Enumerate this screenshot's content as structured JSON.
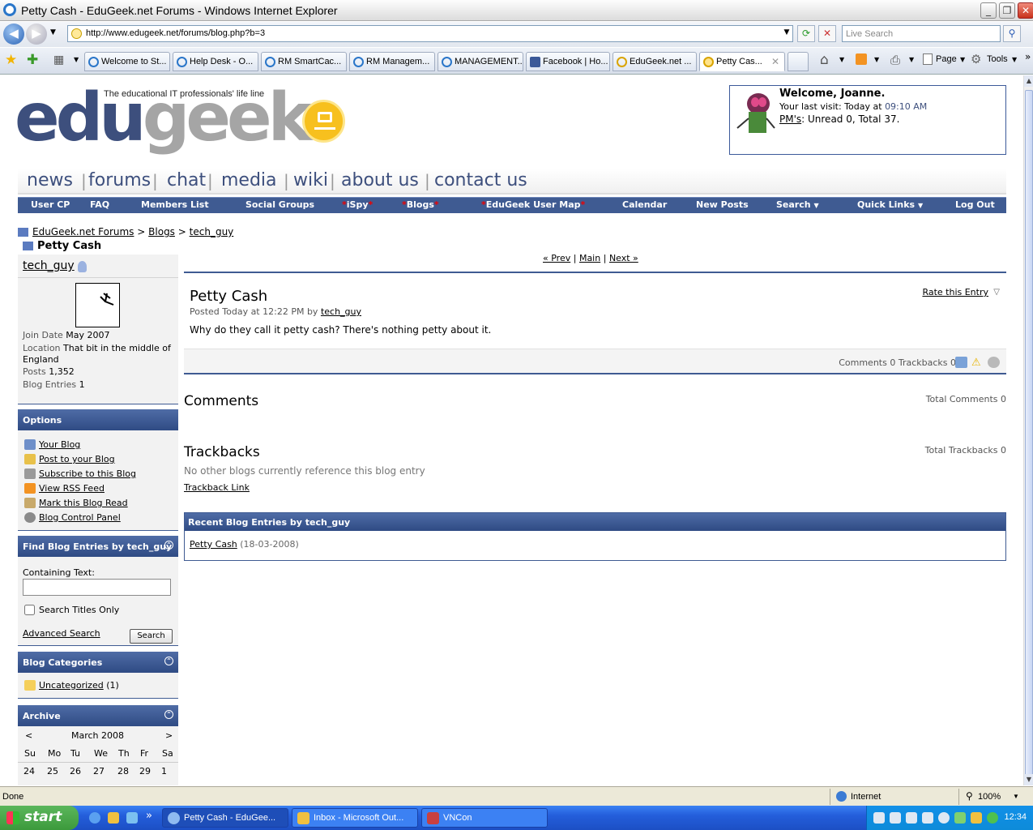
{
  "window": {
    "title": "Petty Cash - EduGeek.net Forums - Windows Internet Explorer"
  },
  "browser": {
    "url": "http://www.edugeek.net/forums/blog.php?b=3",
    "search_placeholder": "Live Search",
    "tabs": [
      "Welcome to St...",
      "Help Desk - O...",
      "RM SmartCac...",
      "RM Managem...",
      "MANAGEMENT...",
      "Facebook | Ho...",
      "EduGeek.net ...",
      "Petty Cas..."
    ],
    "toolbar": {
      "page": "Page",
      "tools": "Tools"
    }
  },
  "site": {
    "tagline": "The educational IT professionals' life line",
    "logo_left": "edu",
    "logo_right": "geek",
    "colors": {
      "nav_blue": "#3f5b92",
      "logo_blue": "#3d4f7d",
      "logo_grey": "#a5a5a5",
      "logo_yellow": "#f7c01e"
    }
  },
  "welcome": {
    "greeting": "Welcome, Joanne.",
    "last_visit_label": "Your last visit: Today at",
    "last_visit_time": "09:10 AM",
    "pms_link": "PM's",
    "pms_text": ": Unread 0, Total 37."
  },
  "main_nav": [
    "news",
    "forums",
    "chat",
    "media",
    "wiki",
    "about us",
    "contact us"
  ],
  "blue_nav": {
    "user_cp": "User CP",
    "faq": "FAQ",
    "members": "Members List",
    "groups": "Social Groups",
    "ispy": "iSpy",
    "blogs": "Blogs",
    "usermap": "EduGeek User Map",
    "calendar": "Calendar",
    "newposts": "New Posts",
    "search": "Search",
    "quicklinks": "Quick Links",
    "logout": "Log Out",
    "star": "*"
  },
  "breadcrumb": {
    "root": "EduGeek.net Forums",
    "blogs": "Blogs",
    "user": "tech_guy",
    "sep": ">",
    "current": "Petty Cash"
  },
  "profile": {
    "username": "tech_guy",
    "join_label": "Join Date",
    "join_value": "May 2007",
    "location_label": "Location",
    "location_value": "That bit in the middle of England",
    "posts_label": "Posts",
    "posts_value": "1,352",
    "entries_label": "Blog Entries",
    "entries_value": "1"
  },
  "options": {
    "title": "Options",
    "items": [
      "Your Blog",
      "Post to your Blog",
      "Subscribe to this Blog",
      "View RSS Feed",
      "Mark this Blog Read",
      "Blog Control Panel"
    ]
  },
  "find": {
    "title": "Find Blog Entries by tech_guy",
    "containing_label": "Containing Text:",
    "titles_only": "Search Titles Only",
    "advanced": "Advanced Search",
    "search_btn": "Search"
  },
  "categories": {
    "title": "Blog Categories",
    "item": "Uncategorized",
    "count": "(1)"
  },
  "archive": {
    "title": "Archive",
    "prev": "<",
    "next": ">",
    "month": "March 2008",
    "days": [
      "Su",
      "Mo",
      "Tu",
      "We",
      "Th",
      "Fr",
      "Sa"
    ],
    "row1": [
      "24",
      "25",
      "26",
      "27",
      "28",
      "29",
      "1"
    ]
  },
  "entry_nav": {
    "prev": "« Prev",
    "main": "Main",
    "next": "Next »",
    "sep": "|"
  },
  "entry": {
    "title": "Petty Cash",
    "posted": "Posted Today at 12:22 PM by",
    "author": "tech_guy",
    "text": "Why do they call it petty cash? There's nothing petty about it.",
    "rate": "Rate this Entry",
    "footer": "Comments 0 Trackbacks 0"
  },
  "comments": {
    "title": "Comments",
    "total": "Total Comments 0"
  },
  "trackbacks": {
    "title": "Trackbacks",
    "total": "Total Trackbacks 0",
    "none": "No other blogs currently reference this blog entry",
    "link": "Trackback Link"
  },
  "recent": {
    "title": "Recent Blog Entries by tech_guy",
    "entry": "Petty Cash",
    "date": "(18-03-2008)"
  },
  "statusbar": {
    "text": "Done",
    "zone": "Internet",
    "zoom": "100%"
  },
  "taskbar": {
    "start": "start",
    "tasks": [
      "Petty Cash - EduGee...",
      "Inbox - Microsoft Out...",
      "VNCon"
    ],
    "clock": "12:34"
  }
}
